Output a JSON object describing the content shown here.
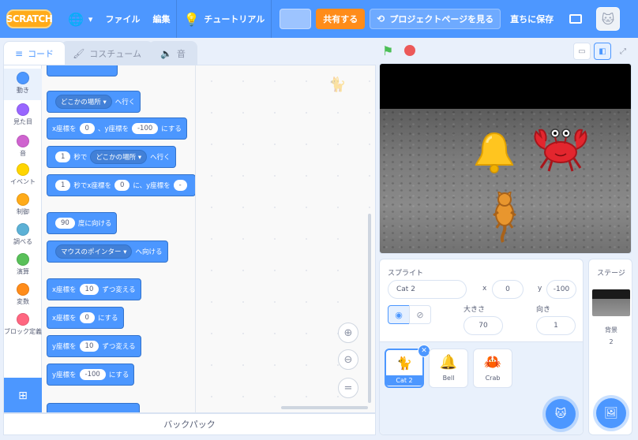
{
  "colors": {
    "menubar": "#4d97ff",
    "motion": "#4c97ff",
    "share": "#ff8c1a",
    "accent": "#4c97ff"
  },
  "menubar": {
    "logo": "SCRATCH",
    "language_icon": "globe-icon",
    "file": "ファイル",
    "edit": "編集",
    "tutorial": "チュートリアル",
    "share": "共有する",
    "project_page": "プロジェクトページを見る",
    "save_now": "直ちに保存"
  },
  "tabs": {
    "code": "コード",
    "costume": "コスチューム",
    "sound": "音"
  },
  "categories": [
    {
      "label": "動き",
      "color": "#4c97ff"
    },
    {
      "label": "見た目",
      "color": "#9966ff"
    },
    {
      "label": "音",
      "color": "#cf63cf"
    },
    {
      "label": "イベント",
      "color": "#ffd500"
    },
    {
      "label": "制御",
      "color": "#ffab19"
    },
    {
      "label": "調べる",
      "color": "#5cb1d6"
    },
    {
      "label": "演算",
      "color": "#59c059"
    },
    {
      "label": "変数",
      "color": "#ff8c1a"
    },
    {
      "label": "ブロック定義",
      "color": "#ff6680"
    }
  ],
  "blocks": {
    "goto": {
      "text": "へ行く",
      "drop": "どこかの場所"
    },
    "gotoxy": {
      "a": "x座標を",
      "x": "0",
      "b": "、y座標を",
      "y": "-100",
      "c": "にする"
    },
    "glide": {
      "n": "1",
      "a": "秒で",
      "drop": "どこかの場所",
      "b": "へ行く"
    },
    "glidexy": {
      "n": "1",
      "a": "秒でx座標を",
      "x": "0",
      "b": "に、y座標を"
    },
    "point": {
      "n": "90",
      "a": "度に向ける"
    },
    "towards": {
      "drop": "マウスのポインター",
      "a": "へ向ける"
    },
    "changex": {
      "a": "x座標を",
      "n": "10",
      "b": "ずつ変える"
    },
    "setx": {
      "a": "x座標を",
      "n": "0",
      "b": "にする"
    },
    "changey": {
      "a": "y座標を",
      "n": "10",
      "b": "ずつ変える"
    },
    "sety": {
      "a": "y座標を",
      "n": "-100",
      "b": "にする"
    }
  },
  "backpack": "バックパック",
  "sprite_info": {
    "label": "スプライト",
    "name": "Cat 2",
    "x_label": "x",
    "x": "0",
    "y_label": "y",
    "y": "-100",
    "size_label": "大きさ",
    "size": "70",
    "direction_label": "向き",
    "direction": "1"
  },
  "sprites": [
    "Cat 2",
    "Bell",
    "Crab"
  ],
  "stage_panel": {
    "label": "ステージ",
    "backdrop_label": "背景",
    "backdrop_count": "2"
  }
}
